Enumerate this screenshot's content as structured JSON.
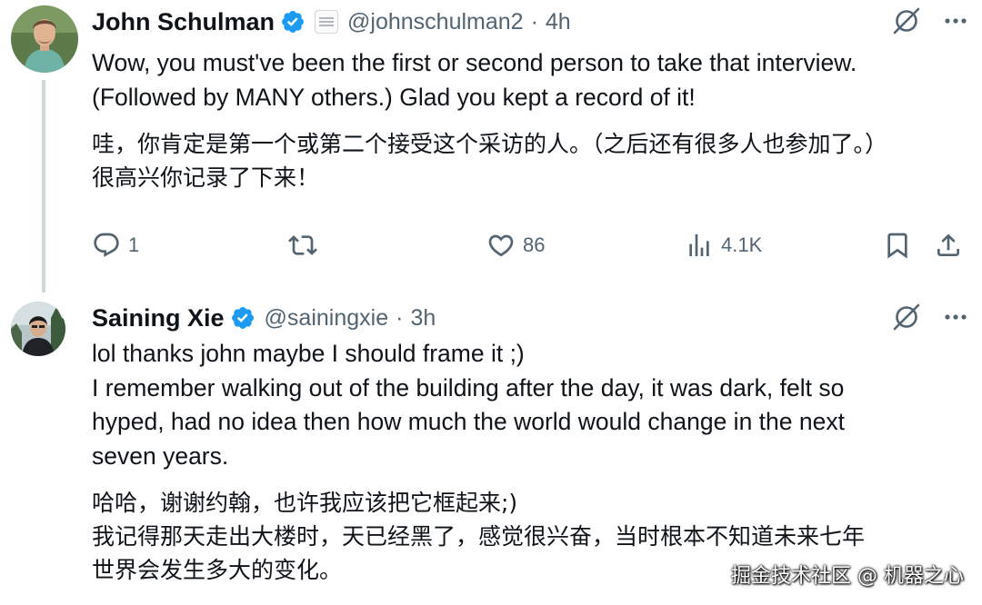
{
  "tweets": [
    {
      "author_name": "John Schulman",
      "handle": "@johnschulman2",
      "dot": "·",
      "time": "4h",
      "text_en": "Wow, you must've been the first or second person to take that interview.\n(Followed by MANY others.) Glad you kept a record of it!",
      "text_zh": "哇，你肯定是第一个或第二个接受这个采访的人。（之后还有很多人也参加了。）\n很高兴你记录了下来！",
      "stats": {
        "replies": "1",
        "likes": "86",
        "views": "4.1K"
      }
    },
    {
      "author_name": "Saining Xie",
      "handle": "@sainingxie",
      "dot": "·",
      "time": "3h",
      "text_en": "lol thanks john maybe I should frame it ;)\nI remember walking out of the building after the day, it was dark, felt so\nhyped, had no idea then how much the world would change in the next\nseven years.",
      "text_zh": "哈哈，谢谢约翰，也许我应该把它框起来;)\n我记得那天走出大楼时，天已经黑了，感觉很兴奋，当时根本不知道未来七年\n世界会发生多大的变化。"
    }
  ],
  "watermark": "掘金技术社区 @ 机器之心",
  "colors": {
    "verified": "#1d9bf0",
    "text": "#0f1419",
    "secondary": "#536471",
    "thread_line": "#cfd9de"
  },
  "icons": [
    "verified-badge-icon",
    "grok-icon",
    "more-icon",
    "reply-icon",
    "retweet-icon",
    "like-icon",
    "views-icon",
    "bookmark-icon",
    "share-icon"
  ]
}
